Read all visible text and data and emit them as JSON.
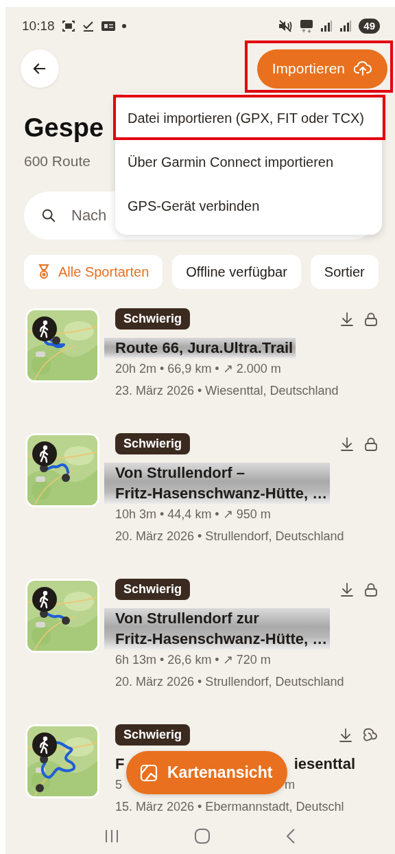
{
  "status_bar": {
    "time": "10:18",
    "battery": "49"
  },
  "import_button": {
    "label": "Importieren",
    "highlighted": true
  },
  "import_menu": {
    "items": [
      {
        "label": "Datei importieren (GPX, FIT oder TCX)",
        "highlighted": true
      },
      {
        "label": "Über Garmin Connect importieren",
        "highlighted": false
      },
      {
        "label": "GPS-Gerät verbinden",
        "highlighted": false
      }
    ]
  },
  "header": {
    "title": "Gespe",
    "subtitle": "600 Route"
  },
  "search": {
    "placeholder": "Nach"
  },
  "filters": [
    {
      "label": "Alle Sportarten",
      "selected": true
    },
    {
      "label": "Offline verfügbar",
      "selected": false
    },
    {
      "label": "Sortier",
      "selected": false
    }
  ],
  "routes": [
    {
      "kind": "full",
      "difficulty": "Schwierig",
      "locked": true,
      "blurred": true,
      "title_lines": [
        "Route 66, Jura.Ultra.Trail"
      ],
      "stats": "20h 2m • 66,9 km • ↗ 2.000 m",
      "meta": "23. März 2026 • Wiesenttal, Deutschland"
    },
    {
      "kind": "full",
      "difficulty": "Schwierig",
      "locked": true,
      "blurred": true,
      "title_lines": [
        "Von Strullendorf –",
        "Fritz-Hasenschwanz-Hütte, …"
      ],
      "stats": "10h 3m • 44,4 km • ↗ 950 m",
      "meta": "20. März 2026 • Strullendorf, Deutschland"
    },
    {
      "kind": "full",
      "difficulty": "Schwierig",
      "locked": true,
      "blurred": true,
      "title_lines": [
        "Von Strullendorf zur",
        "Fritz-Hasenschwanz-Hütte, …"
      ],
      "stats": "6h 13m • 26,6 km • ↗ 720 m",
      "meta": "20. März 2026 • Strullendorf, Deutschland"
    },
    {
      "kind": "covered",
      "difficulty": "Schwierig",
      "locked": false,
      "blurred": false,
      "title_parts": [
        "F",
        "iesenttal"
      ],
      "stats_parts": [
        "5",
        "m"
      ],
      "meta": "15. März 2026 • Ebermannstadt, Deutschl"
    }
  ],
  "map_button": {
    "label": "Kartenansicht"
  }
}
